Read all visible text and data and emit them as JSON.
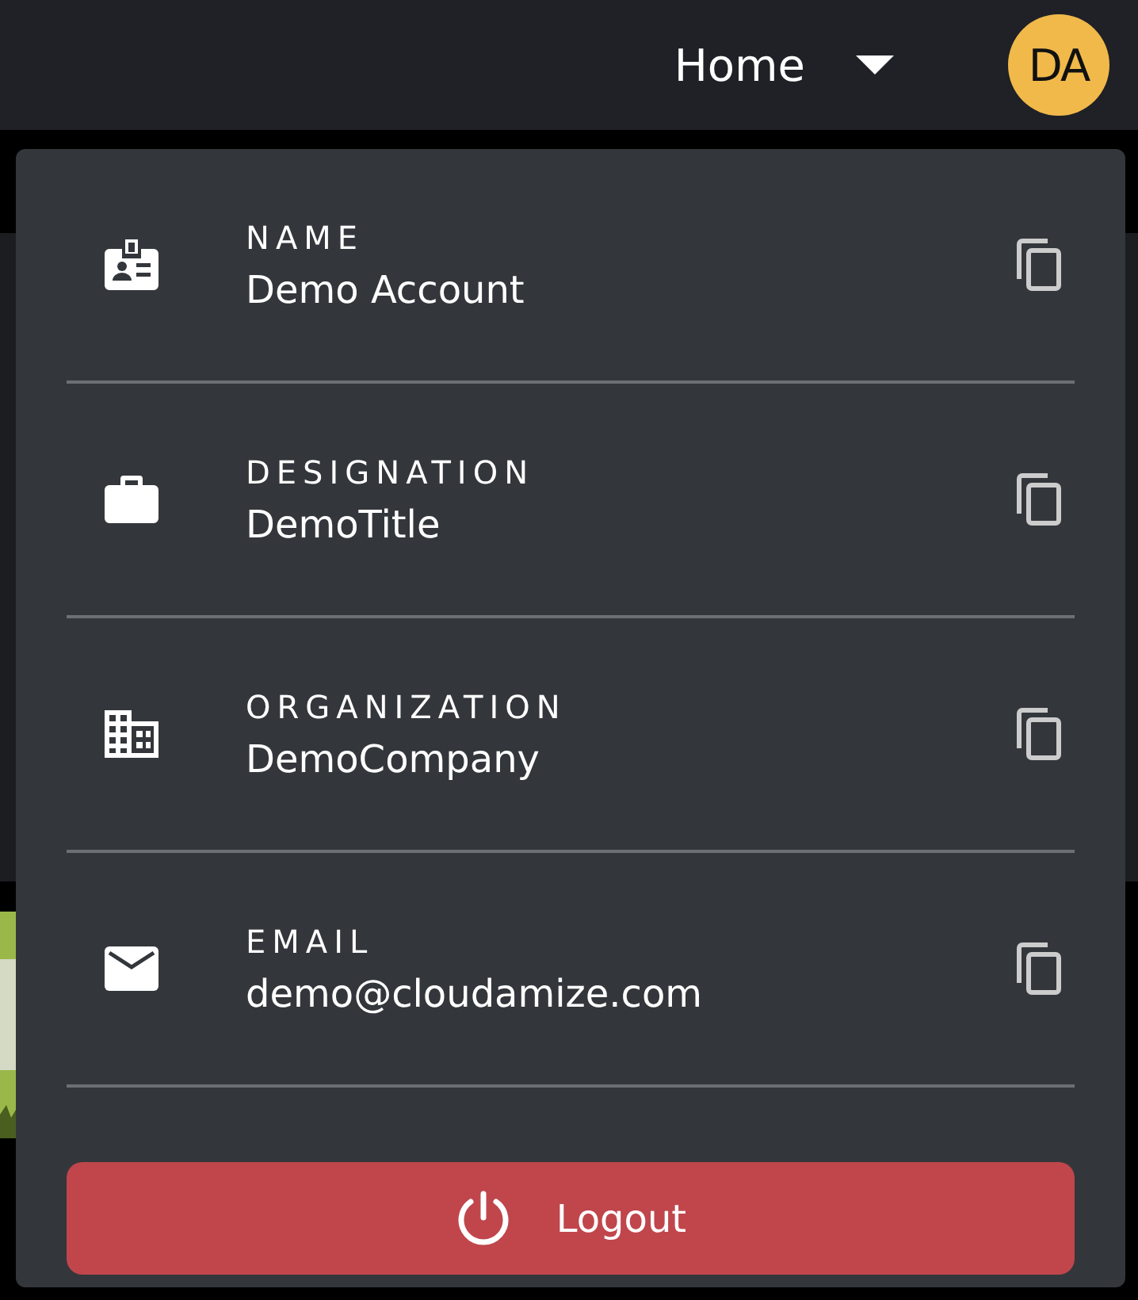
{
  "header": {
    "nav_menu": "Home",
    "avatar": "DA"
  },
  "profile_menu": {
    "fields": [
      {
        "label": "NAME",
        "value": "Demo Account"
      },
      {
        "label": "DESIGNATION",
        "value": "DemoTitle"
      },
      {
        "label": "ORGANIZATION",
        "value": "DemoCompany"
      },
      {
        "label": "EMAIL",
        "value": "demo@cloudamize.com"
      }
    ],
    "logout": "Logout"
  }
}
